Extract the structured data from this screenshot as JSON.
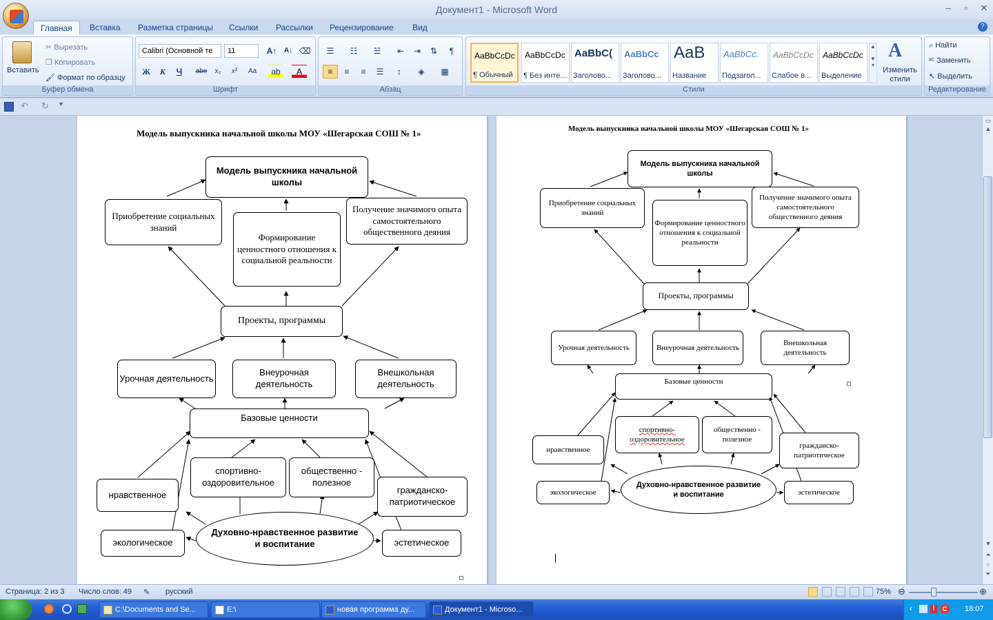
{
  "window": {
    "title": "Документ1 - Microsoft Word"
  },
  "tabs": [
    "Главная",
    "Вставка",
    "Разметка страницы",
    "Ссылки",
    "Рассылки",
    "Рецензирование",
    "Вид"
  ],
  "ribbon": {
    "clipboard": {
      "paste": "Вставить",
      "cut": "Вырезать",
      "copy": "Копировать",
      "format_painter": "Формат по образцу",
      "label": "Буфер обмена"
    },
    "font": {
      "name": "Calibri (Основной те",
      "size": "11",
      "label": "Шрифт"
    },
    "paragraph": {
      "label": "Абзац"
    },
    "styles": {
      "label": "Стили",
      "items": [
        {
          "preview": "AaBbCcDc",
          "name": "¶ Обычный"
        },
        {
          "preview": "AaBbCcDc",
          "name": "¶ Без инте..."
        },
        {
          "preview": "AaBbC(",
          "name": "Заголово..."
        },
        {
          "preview": "AaBbCc",
          "name": "Заголово..."
        },
        {
          "preview": "AaB",
          "name": "Название"
        },
        {
          "preview": "AaBbCc.",
          "name": "Подзагол..."
        },
        {
          "preview": "AaBbCcDc",
          "name": "Слабое в..."
        },
        {
          "preview": "AaBbCcDc",
          "name": "Выделение"
        }
      ],
      "change_styles": "Изменить стили"
    },
    "editing": {
      "find": "Найти",
      "replace": "Заменить",
      "select": "Выделить",
      "label": "Редактирование"
    }
  },
  "diagram": {
    "title": "Модель выпускника начальной школы МОУ «Шегарская СОШ № 1»",
    "top": "Модель выпускника начальной школы",
    "social_knowledge": "Приобретение социальных знаний",
    "value_attitude": "Формирование ценностного отношения к социальной реальности",
    "experience": "Получение значимого опыта самостоятельного общественного деяния",
    "projects": "Проекты, программы",
    "lesson": "Урочная деятельность",
    "extracurricular": "Внеурочная деятельность",
    "outofschool": "Внешкольная деятельность",
    "base_values": "Базовые ценности",
    "sports": "спортивно-оздоровительное",
    "social_useful": "общественно - полезное",
    "moral": "нравственное",
    "civic": "гражданско-патриотическое",
    "ecological": "экологическое",
    "aesthetic": "эстетическое",
    "spiritual": "Духовно-нравственное развитие и воспитание"
  },
  "statusbar": {
    "page": "Страница: 2 из 3",
    "words": "Число слов: 49",
    "language": "русский",
    "zoom": "75%"
  },
  "taskbar": {
    "tasks": [
      "C:\\Documents and Se...",
      "E:\\",
      "новая программа ду...",
      "Документ1 - Microso..."
    ],
    "clock": "18:07"
  }
}
